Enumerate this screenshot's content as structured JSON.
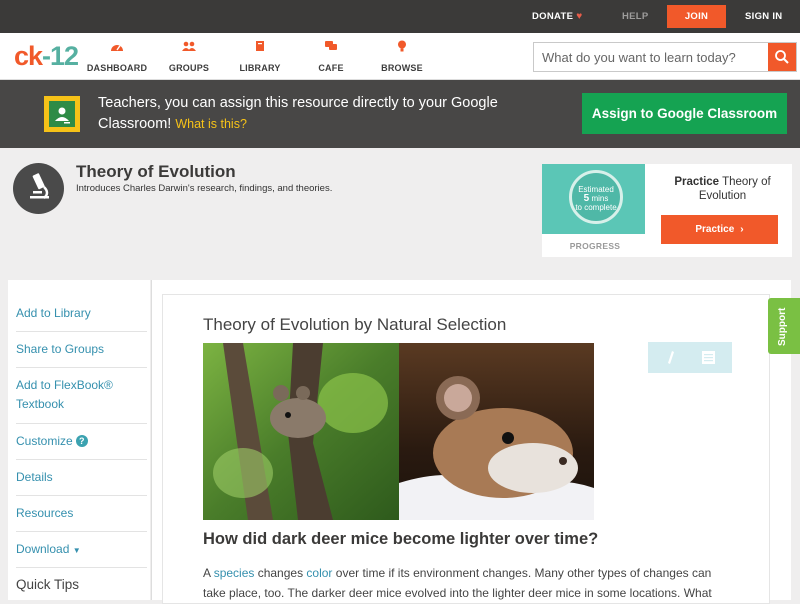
{
  "topbar": {
    "donate": "DONATE",
    "help": "HELP",
    "join": "JOIN",
    "signin": "SIGN IN"
  },
  "logo": {
    "part1": "ck",
    "part2": "-12"
  },
  "nav": [
    {
      "label": "DASHBOARD",
      "icon": "dashboard-icon"
    },
    {
      "label": "GROUPS",
      "icon": "groups-icon"
    },
    {
      "label": "LIBRARY",
      "icon": "library-icon"
    },
    {
      "label": "CAFE",
      "icon": "cafe-icon"
    },
    {
      "label": "BROWSE",
      "icon": "browse-icon"
    }
  ],
  "search": {
    "placeholder": "What do you want to learn today?"
  },
  "banner": {
    "text": "Teachers, you can assign this resource directly to your Google Classroom!",
    "whatis": "What is this?",
    "button": "Assign to Google Classroom"
  },
  "concept": {
    "title": "Theory of Evolution",
    "description": "Introduces Charles Darwin's research, findings, and theories."
  },
  "practice": {
    "estimate_line1": "Estimated",
    "estimate_line2": "5",
    "estimate_line3": "mins",
    "estimate_line4": "to complete",
    "progress": "PROGRESS",
    "title_bold": "Practice",
    "title_rest": "Theory of Evolution",
    "button": "Practice"
  },
  "sidebar": {
    "items": [
      {
        "label": "Add to Library"
      },
      {
        "label": "Share to Groups"
      },
      {
        "label": "Add to FlexBook® Textbook"
      },
      {
        "label": "Customize"
      },
      {
        "label": "Details"
      },
      {
        "label": "Resources"
      },
      {
        "label": "Download"
      }
    ],
    "quick_tips": "Quick Tips"
  },
  "content": {
    "title": "Theory of Evolution by Natural Selection",
    "image_alt": "Deer mice: dark mouse in a tree and light mouse in snow",
    "heading": "How did dark deer mice become lighter over time?",
    "para_a": "A ",
    "para_species": "species",
    "para_b": " changes ",
    "para_color": "color",
    "para_c": " over time if its environment changes. Many other types of changes can take place, too. The darker deer mice evolved into the lighter deer mice in some locations. What"
  },
  "support": "Support",
  "colors": {
    "brand_orange": "#f1592a",
    "brand_teal": "#56b0a1",
    "classroom_green": "#15a352",
    "link_blue": "#3590ae",
    "support_green": "#7ac043"
  }
}
